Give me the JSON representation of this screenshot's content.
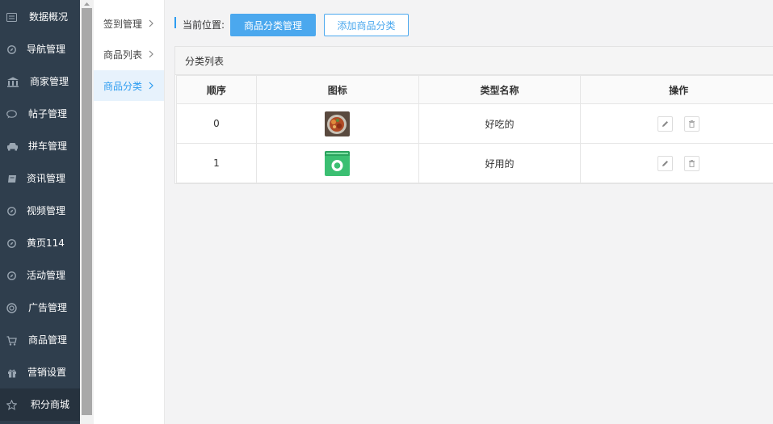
{
  "sidebar": {
    "items": [
      {
        "label": "数据概况",
        "icon": "dashboard-icon",
        "active": false
      },
      {
        "label": "导航管理",
        "icon": "compass-icon",
        "active": false
      },
      {
        "label": "商家管理",
        "icon": "bank-icon",
        "active": false
      },
      {
        "label": "帖子管理",
        "icon": "chat-bubble-icon",
        "active": false
      },
      {
        "label": "拼车管理",
        "icon": "car-icon",
        "active": false
      },
      {
        "label": "资讯管理",
        "icon": "book-icon",
        "active": false
      },
      {
        "label": "视频管理",
        "icon": "compass-icon",
        "active": false
      },
      {
        "label": "黄页114",
        "icon": "compass-icon",
        "active": false
      },
      {
        "label": "活动管理",
        "icon": "compass-icon",
        "active": false
      },
      {
        "label": "广告管理",
        "icon": "lifebuoy-icon",
        "active": false
      },
      {
        "label": "商品管理",
        "icon": "cart-icon",
        "active": false
      },
      {
        "label": "营销设置",
        "icon": "gift-icon",
        "active": false
      },
      {
        "label": "积分商城",
        "icon": "star-icon",
        "active": true
      }
    ]
  },
  "submenu": {
    "items": [
      {
        "label": "签到管理",
        "active": false
      },
      {
        "label": "商品列表",
        "active": false
      },
      {
        "label": "商品分类",
        "active": true
      }
    ]
  },
  "header": {
    "location_label": "当前位置:",
    "primary_button": "商品分类管理",
    "secondary_button": "添加商品分类"
  },
  "panel": {
    "title": "分类列表",
    "columns": [
      "顺序",
      "图标",
      "类型名称",
      "操作"
    ],
    "rows": [
      {
        "order": "0",
        "icon": "food-image",
        "name": "好吃的"
      },
      {
        "order": "1",
        "icon": "green-box-image",
        "name": "好用的"
      }
    ]
  },
  "colors": {
    "sidebar_bg": "#2f3e4d",
    "accent": "#4ba8ee",
    "active_text": "#2c9cf0"
  }
}
